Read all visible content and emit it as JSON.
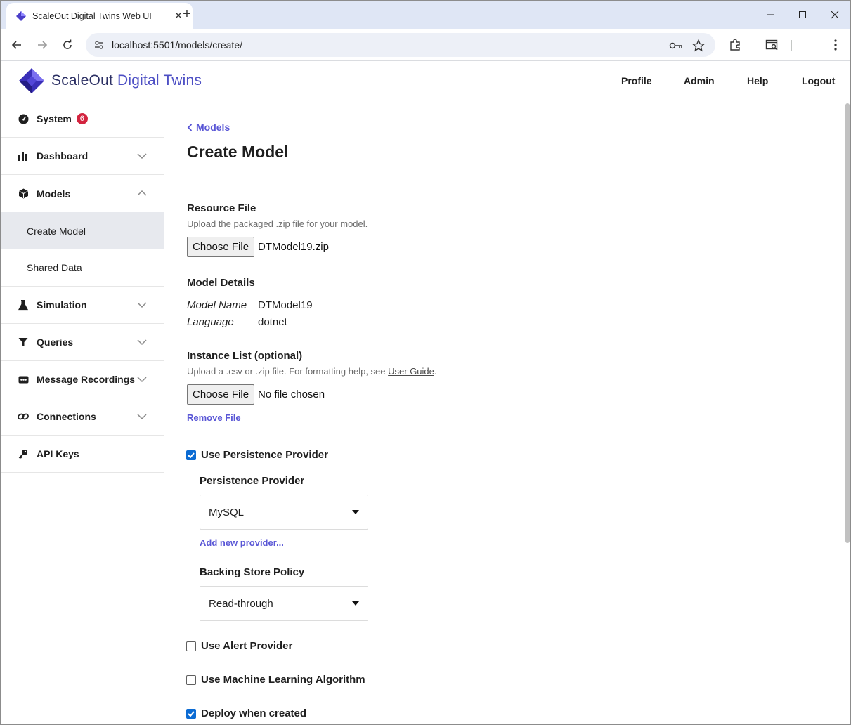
{
  "browser": {
    "tab_title": "ScaleOut Digital Twins Web UI",
    "url": "localhost:5501/models/create/"
  },
  "header": {
    "brand_prefix": "ScaleOut",
    "brand_accent": "Digital Twins",
    "nav": [
      "Profile",
      "Admin",
      "Help",
      "Logout"
    ]
  },
  "sidebar": {
    "items": [
      {
        "label": "System",
        "icon": "gauge-icon",
        "badge": "6"
      },
      {
        "label": "Dashboard",
        "icon": "bar-chart-icon"
      },
      {
        "label": "Models",
        "icon": "cube-icon"
      },
      {
        "label": "Create Model"
      },
      {
        "label": "Shared Data"
      },
      {
        "label": "Simulation",
        "icon": "flask-icon"
      },
      {
        "label": "Queries",
        "icon": "funnel-icon"
      },
      {
        "label": "Message Recordings",
        "icon": "recording-icon"
      },
      {
        "label": "Connections",
        "icon": "link-icon"
      },
      {
        "label": "API Keys",
        "icon": "key-icon"
      }
    ]
  },
  "page": {
    "breadcrumb": "Models",
    "title": "Create Model",
    "resource": {
      "title": "Resource File",
      "help": "Upload the packaged .zip file for your model.",
      "button": "Choose File",
      "file": "DTModel19.zip"
    },
    "details": {
      "title": "Model Details",
      "name_key": "Model Name",
      "name_val": "DTModel19",
      "lang_key": "Language",
      "lang_val": "dotnet"
    },
    "instances": {
      "title": "Instance List (optional)",
      "help_prefix": "Upload a .csv or .zip file. For formatting help, see",
      "help_link": "User Guide",
      "help_suffix": ".",
      "button": "Choose File",
      "file": "No file chosen",
      "remove": "Remove File"
    },
    "persistence": {
      "checkbox_label": "Use Persistence Provider",
      "checked": true,
      "provider_label": "Persistence Provider",
      "provider_value": "MySQL",
      "add_provider": "Add new provider...",
      "policy_label": "Backing Store Policy",
      "policy_value": "Read-through"
    },
    "alert": {
      "label": "Use Alert Provider",
      "checked": false
    },
    "ml": {
      "label": "Use Machine Learning Algorithm",
      "checked": false
    },
    "deploy": {
      "label": "Deploy when created",
      "checked": true
    }
  },
  "colors": {
    "accent": "#5a57d6",
    "badge": "#d3243f",
    "checkbox": "#0b6bd3"
  }
}
